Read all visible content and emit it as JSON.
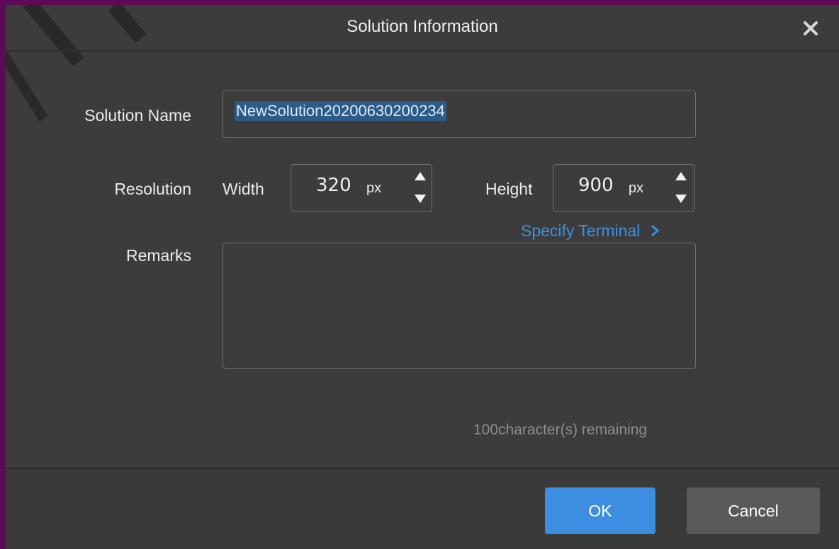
{
  "dialog": {
    "title": "Solution Information",
    "close_icon": "close-icon"
  },
  "form": {
    "solution_name_label": "Solution Name",
    "solution_name_value": "NewSolution20200630200234",
    "resolution_label": "Resolution",
    "width_label": "Width",
    "width_value": "320",
    "width_unit": "px",
    "height_label": "Height",
    "height_value": "900",
    "height_unit": "px",
    "specify_terminal_link": "Specify Terminal",
    "specify_terminal_icon": "chevron-right-icon",
    "remarks_label": "Remarks",
    "remarks_value": "",
    "remaining_text": "100character(s) remaining"
  },
  "footer": {
    "ok_label": "OK",
    "cancel_label": "Cancel"
  },
  "colors": {
    "backdrop": "#5c0a55",
    "dialog_bg": "#3c3c3c",
    "accent": "#3d8ee0",
    "ok_button": "#3d8ee0",
    "cancel_button": "#595959",
    "selection": "#2d5a86"
  }
}
